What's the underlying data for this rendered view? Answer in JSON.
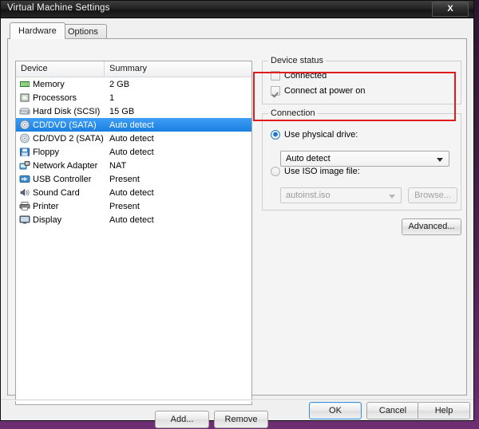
{
  "window": {
    "title": "Virtual Machine Settings",
    "close_label": "X"
  },
  "tabs": [
    {
      "label": "Hardware",
      "active": true
    },
    {
      "label": "Options",
      "active": false
    }
  ],
  "device_list": {
    "columns": {
      "device": "Device",
      "summary": "Summary"
    },
    "rows": [
      {
        "icon": "memory-icon",
        "device": "Memory",
        "summary": "2 GB",
        "selected": false
      },
      {
        "icon": "processor-icon",
        "device": "Processors",
        "summary": "1",
        "selected": false
      },
      {
        "icon": "hard-disk-icon",
        "device": "Hard Disk (SCSI)",
        "summary": "15 GB",
        "selected": false
      },
      {
        "icon": "cd-dvd-icon",
        "device": "CD/DVD (SATA)",
        "summary": "Auto detect",
        "selected": true
      },
      {
        "icon": "cd-dvd-icon",
        "device": "CD/DVD 2 (SATA)",
        "summary": "Auto detect",
        "selected": false
      },
      {
        "icon": "floppy-icon",
        "device": "Floppy",
        "summary": "Auto detect",
        "selected": false
      },
      {
        "icon": "network-adapter-icon",
        "device": "Network Adapter",
        "summary": "NAT",
        "selected": false
      },
      {
        "icon": "usb-controller-icon",
        "device": "USB Controller",
        "summary": "Present",
        "selected": false
      },
      {
        "icon": "sound-card-icon",
        "device": "Sound Card",
        "summary": "Auto detect",
        "selected": false
      },
      {
        "icon": "printer-icon",
        "device": "Printer",
        "summary": "Present",
        "selected": false
      },
      {
        "icon": "display-icon",
        "device": "Display",
        "summary": "Auto detect",
        "selected": false
      }
    ],
    "add_label": "Add...",
    "remove_label": "Remove"
  },
  "device_status": {
    "title": "Device status",
    "connected_label": "Connected",
    "connected_checked": false,
    "connect_at_power_on_label": "Connect at power on",
    "connect_at_power_on_checked": true
  },
  "connection": {
    "title": "Connection",
    "physical_drive_label": "Use physical drive:",
    "physical_drive_selected": true,
    "physical_drive_value": "Auto detect",
    "iso_label": "Use ISO image file:",
    "iso_selected": false,
    "iso_value": "autoinst.iso",
    "browse_label": "Browse...",
    "advanced_label": "Advanced..."
  },
  "footer": {
    "ok_label": "OK",
    "cancel_label": "Cancel",
    "help_label": "Help"
  },
  "colors": {
    "selection_blue": "#1a7fe0",
    "annotation_red": "#e01b1b",
    "titlebar_dark": "#1b1b1b",
    "desktop_purple": "#6d2f72"
  }
}
